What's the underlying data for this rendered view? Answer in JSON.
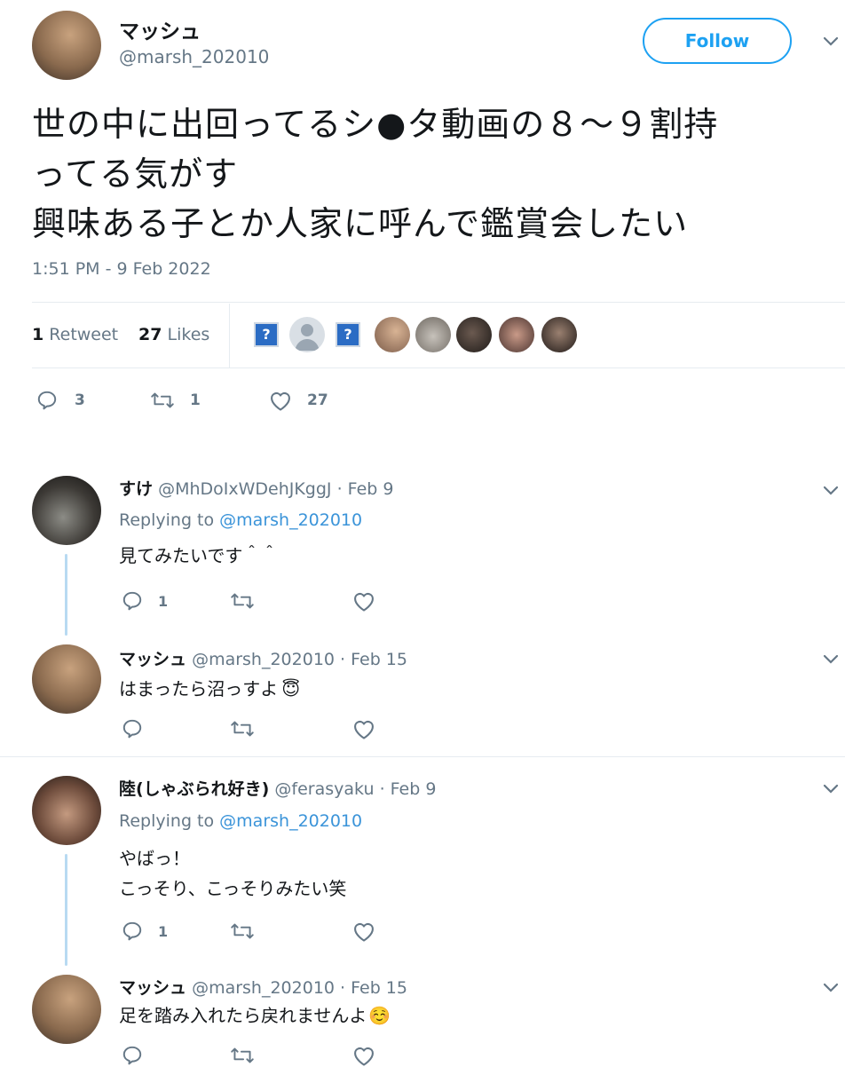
{
  "tweet": {
    "author_name": "マッシュ",
    "author_handle": "@marsh_202010",
    "follow_label": "Follow",
    "text_lines": [
      "世の中に出回ってるシ●タ動画の８〜９割持",
      "ってる気がす",
      "興味ある子とか人家に呼んで鑑賞会したい"
    ],
    "timestamp": "1:51 PM - 9 Feb 2022",
    "retweet_count": "1",
    "retweet_label": "Retweet",
    "like_count": "27",
    "like_label": "Likes",
    "reply_action_count": "3",
    "retweet_action_count": "1",
    "like_action_count": "27",
    "likers_unknown_glyph": "?"
  },
  "replies": [
    {
      "name": "すけ",
      "handle": "@MhDoIxWDehJKggJ",
      "date": "· Feb 9",
      "replying_prefix": "Replying to",
      "replying_handle": "@marsh_202010",
      "text": "見てみたいです＾＾",
      "reply_count": "1"
    },
    {
      "name": "マッシュ",
      "handle": "@marsh_202010",
      "date": "· Feb 15",
      "text": "はまったら沼っすよ",
      "emoji": "😇"
    },
    {
      "name": "陸(しゃぶられ好き)",
      "handle": "@ferasyaku",
      "date": "· Feb 9",
      "replying_prefix": "Replying to",
      "replying_handle": "@marsh_202010",
      "text_line1": "やばっ！",
      "text_line2": "こっそり、こっそりみたい笑",
      "reply_count": "1"
    },
    {
      "name": "マッシュ",
      "handle": "@marsh_202010",
      "date": "· Feb 15",
      "text": "足を踏み入れたら戻れませんよ",
      "emoji": "☺️"
    }
  ],
  "colors": {
    "text": "#14171a",
    "secondary": "#657786",
    "link": "#3b94d9",
    "follow_border": "#1da1f2",
    "thread_line": "#b8daf2",
    "divider": "#e6ecf0"
  },
  "icons": [
    "chevron-down-icon",
    "reply-icon",
    "retweet-icon",
    "like-icon"
  ]
}
